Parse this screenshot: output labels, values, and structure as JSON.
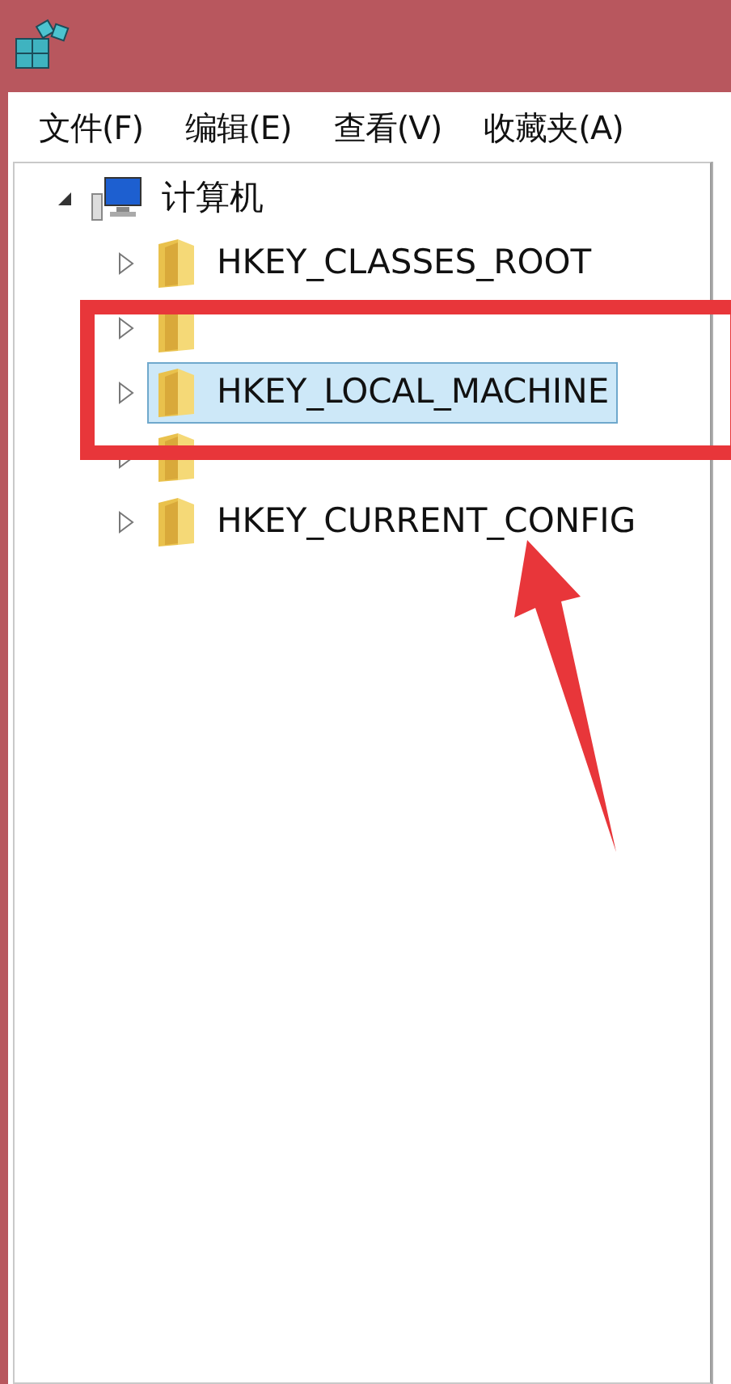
{
  "menu": [
    {
      "label": "文件(F)"
    },
    {
      "label": "编辑(E)"
    },
    {
      "label": "查看(V)"
    },
    {
      "label": "收藏夹(A)"
    }
  ],
  "tree": {
    "label": "计算机",
    "expanded": true,
    "children": [
      {
        "label": "HKEY_CLASSES_ROOT",
        "expanded": false,
        "selected": false
      },
      {
        "expanded": false,
        "selected": false
      },
      {
        "label": "HKEY_LOCAL_MACHINE",
        "expanded": false,
        "selected": true
      },
      {
        "expanded": false,
        "selected": false
      },
      {
        "label": "HKEY_CURRENT_CONFIG",
        "expanded": false,
        "selected": false
      }
    ]
  }
}
